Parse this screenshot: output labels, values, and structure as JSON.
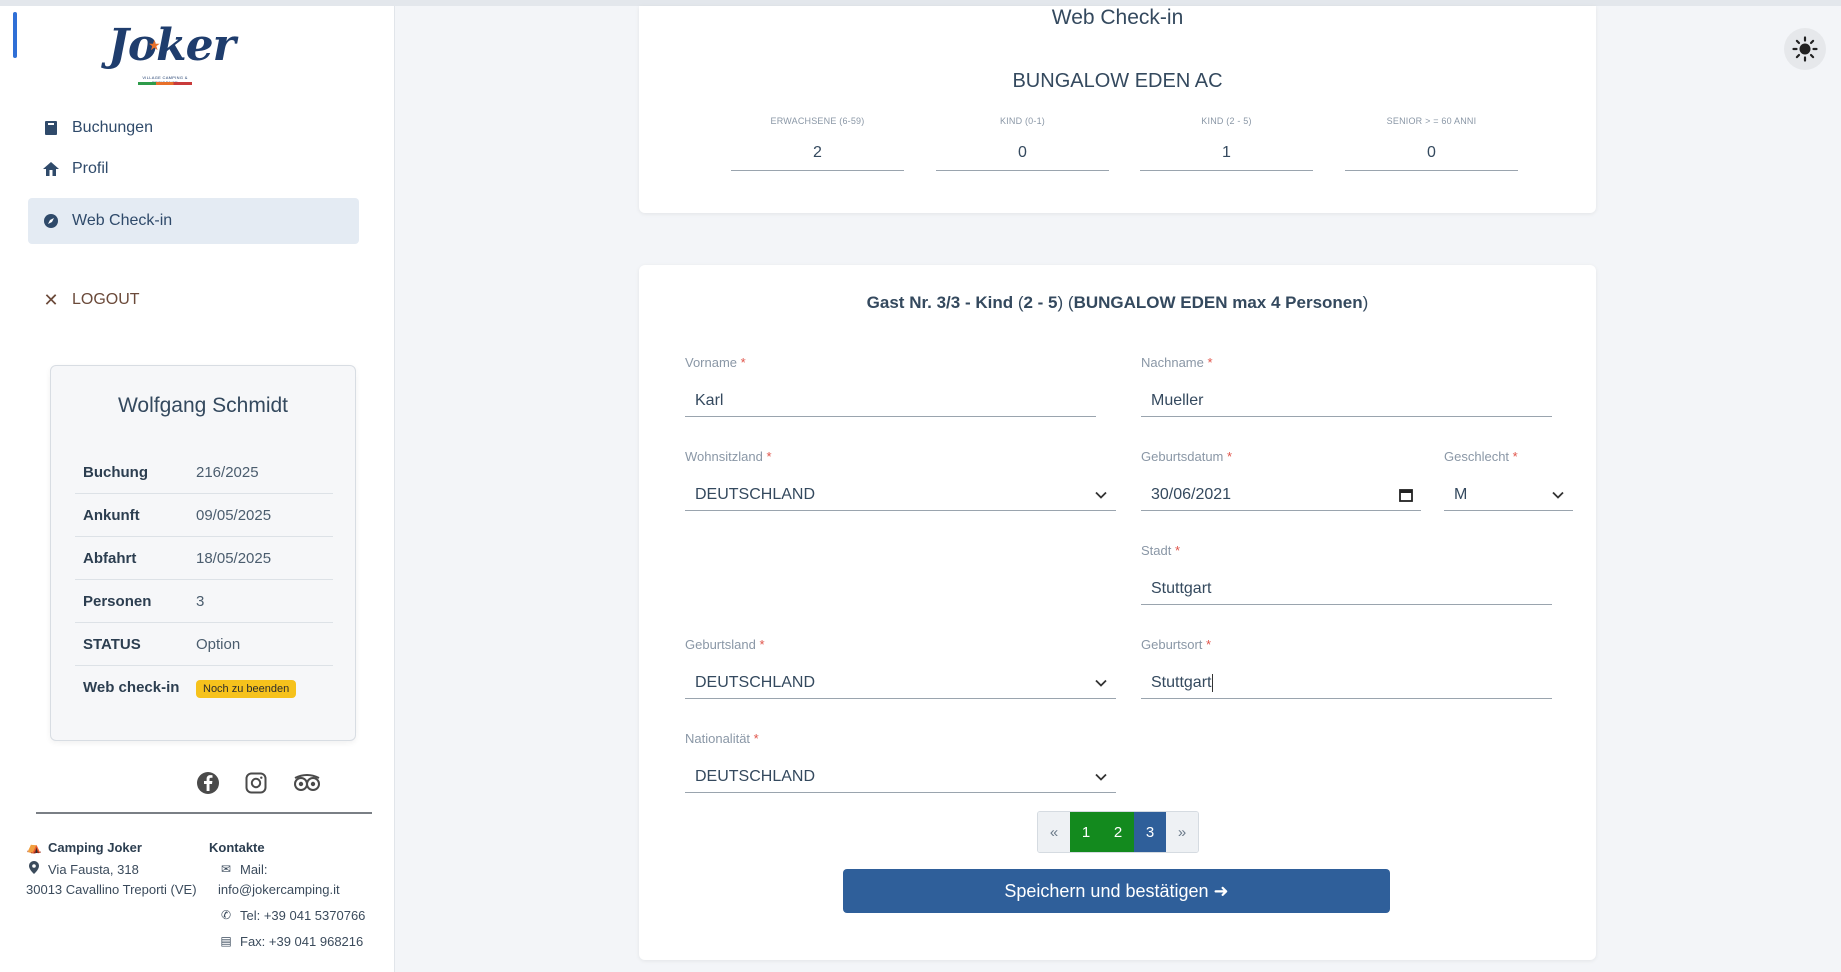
{
  "brand": {
    "logo_text": "Joker",
    "logo_sub": "VILLAGE CAMPING & RESIDENCE"
  },
  "sidebar": {
    "items": [
      {
        "label": "Buchungen",
        "icon": "book-icon"
      },
      {
        "label": "Profil",
        "icon": "home-icon"
      },
      {
        "label": "Web Check-in",
        "icon": "compass-icon"
      }
    ],
    "logout": "LOGOUT"
  },
  "user_card": {
    "name": "Wolfgang Schmidt",
    "rows": [
      {
        "key": "Buchung",
        "value": "216/2025"
      },
      {
        "key": "Ankunft",
        "value": "09/05/2025"
      },
      {
        "key": "Abfahrt",
        "value": "18/05/2025"
      },
      {
        "key": "Personen",
        "value": "3"
      },
      {
        "key": "STATUS",
        "value": "Option"
      },
      {
        "key": "Web check-in",
        "value": "Noch zu beenden"
      }
    ],
    "badge_color": "#f6c21c"
  },
  "socials": [
    "facebook-icon",
    "instagram-icon",
    "tripadvisor-icon"
  ],
  "footer": {
    "camp_name": "Camping Joker",
    "address1": "Via Fausta, 318",
    "address2": "30013 Cavallino Treporti (VE)",
    "contacts_title": "Kontakte",
    "mail_label": "Mail:",
    "mail": "info@jokercamping.it",
    "tel": "Tel: +39 041 5370766",
    "fax": "Fax: +39 041 968216"
  },
  "checkin": {
    "title": "Web Check-in",
    "unit": "BUNGALOW EDEN AC",
    "counts": [
      {
        "label": "ERWACHSENE (6-59)",
        "value": "2"
      },
      {
        "label": "KIND (0-1)",
        "value": "0"
      },
      {
        "label": "KIND (2 - 5)",
        "value": "1"
      },
      {
        "label": "SENIOR > = 60 ANNI",
        "value": "0"
      }
    ]
  },
  "guest": {
    "title_bold1": "Gast Nr. 3/3 - Kind",
    "title_norm1": " (",
    "title_bold2": "2 - 5",
    "title_norm2": ") (",
    "title_bold3": "BUNGALOW EDEN max 4 Personen",
    "title_norm3": ")",
    "fields": {
      "vorname": {
        "label": "Vorname",
        "value": "Karl"
      },
      "nachname": {
        "label": "Nachname",
        "value": "Mueller"
      },
      "wohnsitzland": {
        "label": "Wohnsitzland",
        "value": "DEUTSCHLAND"
      },
      "geburtsdatum": {
        "label": "Geburtsdatum",
        "value": "30/06/2021"
      },
      "geschlecht": {
        "label": "Geschlecht",
        "value": "M"
      },
      "stadt": {
        "label": "Stadt",
        "value": "Stuttgart"
      },
      "geburtsland": {
        "label": "Geburtsland",
        "value": "DEUTSCHLAND"
      },
      "geburtsort": {
        "label": "Geburtsort",
        "value": "Stuttgart"
      },
      "nationalitaet": {
        "label": "Nationalität",
        "value": "DEUTSCHLAND"
      }
    },
    "required_mark": "*"
  },
  "pager": {
    "prev": "«",
    "pages": [
      "1",
      "2",
      "3"
    ],
    "next": "»",
    "current": 3
  },
  "save_button": "Speichern und bestätigen ➜",
  "colors": {
    "primary": "#2f5f9a",
    "done_page": "#138a1e",
    "required": "#e0544a"
  }
}
